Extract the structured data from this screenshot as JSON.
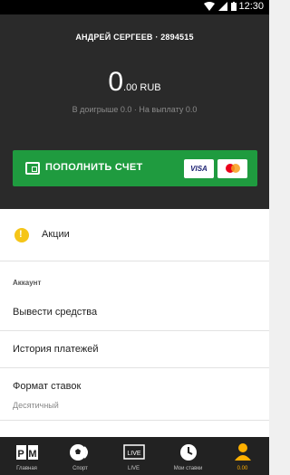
{
  "status_bar": {
    "time": "12:30"
  },
  "account": {
    "user_line": "АНДРЕЙ СЕРГЕЕВ · 2894515",
    "balance_int": "0",
    "balance_suffix": ".00 RUB",
    "sub_balance": "В доигрыше 0.0 · На выплату 0.0"
  },
  "deposit_button": {
    "label": "ПОПОЛНИТЬ СЧЕТ",
    "visa": "VISA"
  },
  "promo": {
    "label": "Акции"
  },
  "account_section": {
    "header": "Аккаунт",
    "items": [
      {
        "label": "Вывести средства"
      },
      {
        "label": "История платежей"
      },
      {
        "label": "Формат ставок",
        "value": "Десятичный"
      }
    ]
  },
  "bottom_nav": {
    "tabs": [
      {
        "label": "Главная",
        "icon": "logo-icon"
      },
      {
        "label": "Спорт",
        "icon": "soccer-ball-icon"
      },
      {
        "label": "LIVE",
        "icon": "live-tv-icon",
        "icon_text": "LIVE"
      },
      {
        "label": "Мои ставки",
        "icon": "clock-icon"
      },
      {
        "label": "0.00",
        "icon": "profile-icon",
        "active": true
      }
    ]
  },
  "colors": {
    "accent": "#ffb000",
    "deposit_green": "#1f9b3f",
    "panel": "#2a2a2a"
  }
}
